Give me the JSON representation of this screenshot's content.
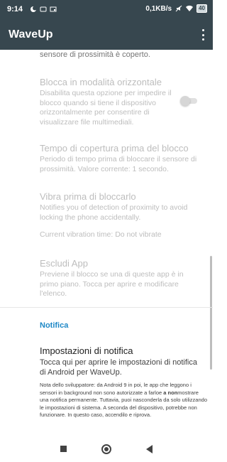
{
  "status_bar": {
    "time": "9:14",
    "network_speed": "0,1KB/s",
    "battery": "40"
  },
  "app_bar": {
    "title": "WaveUp"
  },
  "prefs": {
    "prev_summary_tail": "sensore di prossimità è coperto.",
    "landscape": {
      "title": "Blocca in modalità orizzontale",
      "summary": "Disabilita questa opzione per impedire il blocco quando si tiene il dispositivo orizzontalmente per consentire di visualizzare file multimediali.",
      "enabled": false
    },
    "cover_time": {
      "title": "Tempo di copertura prima del blocco",
      "summary": "Periodo di tempo prima di bloccare il sensore di prossimità. Valore corrente: 1 secondo."
    },
    "vibrate": {
      "title": "Vibra prima di bloccarlo",
      "summary": "Notifies you of detection of proximity to avoid locking the phone accidentally.",
      "current": "Current vibration time: Do not vibrate"
    },
    "exclude_apps": {
      "title": "Escludi App",
      "summary": "Previene il blocco se una di queste app è in primo piano. Tocca per aprire e modificare l'elenco."
    }
  },
  "notification_section": {
    "header": "Notifica",
    "settings_title": "Impostazioni di notifica",
    "settings_summary": "Tocca qui per aprire le impostazioni di notifica di Android per WaveUp.",
    "note_part1": "Nota dello sviluppatore: da Android 9 in poi, le app che leggono i sensori in background non sono autorizzate a farloe ",
    "note_bold": "a non",
    "note_part2": "mostrare una notifica permanente. Tuttavia, puoi nasconderla da solo utilizzando le impostazioni di sistema. A seconda del dispositivo, potrebbe non funzionare. In questo caso, accendilo e riprova."
  },
  "icons": {
    "overflow": "more-vert-icon",
    "nav_recents": "square-icon",
    "nav_home": "circle-icon",
    "nav_back": "triangle-back-icon"
  },
  "colors": {
    "app_bar": "#37474f",
    "accent": "#1e88c6",
    "disabled_text": "#bdbdbd"
  }
}
